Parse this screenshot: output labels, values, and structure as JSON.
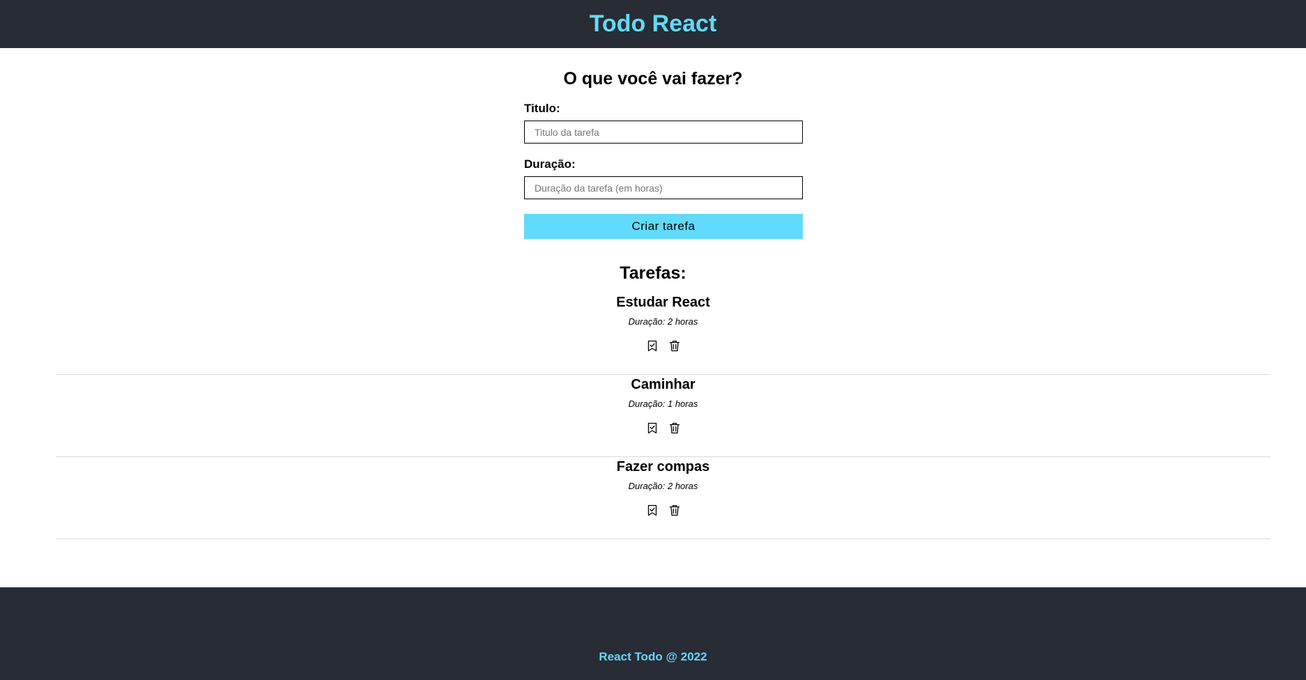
{
  "header": {
    "title": "Todo React"
  },
  "form": {
    "heading": "O que você vai fazer?",
    "title_label": "Titulo:",
    "title_placeholder": "Titulo da tarefa",
    "title_value": "",
    "duration_label": "Duração:",
    "duration_placeholder": "Duração da tarefa (em horas)",
    "duration_value": "",
    "submit_label": "Criar tarefa"
  },
  "tasks": {
    "heading": "Tarefas:",
    "items": [
      {
        "title": "Estudar React",
        "duration": "Duração: 2 horas",
        "actions": [
          "bookmark-check-icon",
          "trash-icon"
        ]
      },
      {
        "title": "Caminhar",
        "duration": "Duração: 1 horas",
        "actions": [
          "bookmark-check-icon",
          "trash-icon"
        ]
      },
      {
        "title": "Fazer compas",
        "duration": "Duração: 2 horas",
        "actions": [
          "bookmark-check-icon",
          "trash-icon"
        ]
      }
    ]
  },
  "footer": {
    "text": "React Todo @ 2022"
  },
  "colors": {
    "header_bg": "#282c34",
    "accent": "#61dafb",
    "divider": "#d9d9d9"
  }
}
